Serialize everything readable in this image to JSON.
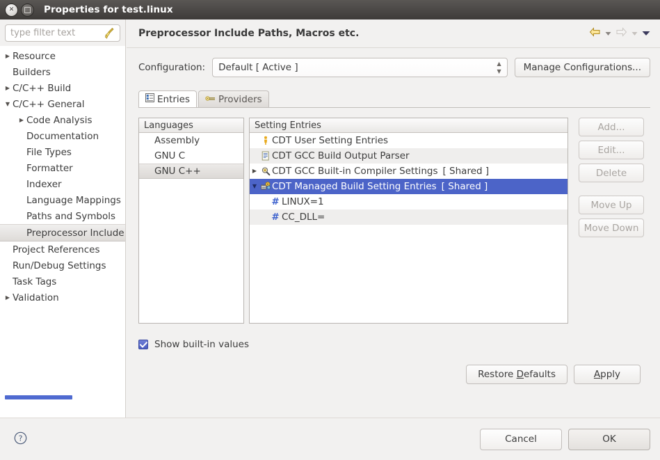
{
  "window": {
    "title": "Properties for test.linux",
    "close_icon": "close-icon",
    "maximize_icon": "maximize-icon"
  },
  "sidebar": {
    "filter_placeholder": "type filter text",
    "filter_value": "",
    "clear_icon": "broom-icon",
    "items": [
      {
        "label": "Resource",
        "indent": 0,
        "arrow": "collapsed",
        "selected": false
      },
      {
        "label": "Builders",
        "indent": 0,
        "arrow": "none",
        "selected": false
      },
      {
        "label": "C/C++ Build",
        "indent": 0,
        "arrow": "collapsed",
        "selected": false
      },
      {
        "label": "C/C++ General",
        "indent": 0,
        "arrow": "expanded",
        "selected": false
      },
      {
        "label": "Code Analysis",
        "indent": 1,
        "arrow": "collapsed",
        "selected": false
      },
      {
        "label": "Documentation",
        "indent": 1,
        "arrow": "none",
        "selected": false
      },
      {
        "label": "File Types",
        "indent": 1,
        "arrow": "none",
        "selected": false
      },
      {
        "label": "Formatter",
        "indent": 1,
        "arrow": "none",
        "selected": false
      },
      {
        "label": "Indexer",
        "indent": 1,
        "arrow": "none",
        "selected": false
      },
      {
        "label": "Language Mappings",
        "indent": 1,
        "arrow": "none",
        "selected": false
      },
      {
        "label": "Paths and Symbols",
        "indent": 1,
        "arrow": "none",
        "selected": false
      },
      {
        "label": "Preprocessor Include",
        "indent": 1,
        "arrow": "none",
        "selected": true
      },
      {
        "label": "Project References",
        "indent": 0,
        "arrow": "none",
        "selected": false
      },
      {
        "label": "Run/Debug Settings",
        "indent": 0,
        "arrow": "none",
        "selected": false
      },
      {
        "label": "Task Tags",
        "indent": 0,
        "arrow": "none",
        "selected": false
      },
      {
        "label": "Validation",
        "indent": 0,
        "arrow": "collapsed",
        "selected": false
      }
    ]
  },
  "page": {
    "title": "Preprocessor Include Paths, Macros etc.",
    "nav": {
      "back_icon": "back-arrow-icon",
      "back_menu_icon": "back-dropdown-icon",
      "forward_icon": "forward-arrow-icon",
      "forward_menu_icon": "forward-dropdown-icon",
      "view_menu_icon": "view-menu-icon"
    }
  },
  "configuration": {
    "label": "Configuration:",
    "value": "Default  [ Active ]",
    "manage_button": "Manage Configurations..."
  },
  "tabs": [
    {
      "label": "Entries",
      "icon": "entries-icon",
      "active": true
    },
    {
      "label": "Providers",
      "icon": "providers-icon",
      "active": false
    }
  ],
  "languages": {
    "header": "Languages",
    "items": [
      {
        "label": "Assembly",
        "selected": false
      },
      {
        "label": "GNU C",
        "selected": false
      },
      {
        "label": "GNU C++",
        "selected": true
      }
    ]
  },
  "setting_entries": {
    "header": "Setting Entries",
    "rows": [
      {
        "kind": "provider",
        "label": "CDT User Setting Entries",
        "shared": "",
        "icon": "user-setting-icon",
        "arrow": "none",
        "selected": false,
        "alt": false
      },
      {
        "kind": "provider",
        "label": "CDT GCC Build Output Parser",
        "shared": "",
        "icon": "output-parser-icon",
        "arrow": "none",
        "selected": false,
        "alt": true
      },
      {
        "kind": "provider",
        "label": "CDT GCC Built-in Compiler Settings",
        "shared": "[ Shared ]",
        "icon": "compiler-settings-icon",
        "arrow": "collapsed",
        "selected": false,
        "alt": false
      },
      {
        "kind": "provider",
        "label": "CDT Managed Build Setting Entries",
        "shared": "[ Shared ]",
        "icon": "managed-build-icon",
        "arrow": "expanded",
        "selected": true,
        "alt": false
      },
      {
        "kind": "macro",
        "label": "LINUX=1",
        "shared": "",
        "icon": "macro-icon",
        "arrow": "none",
        "selected": false,
        "alt": false
      },
      {
        "kind": "macro",
        "label": "CC_DLL=",
        "shared": "",
        "icon": "macro-icon",
        "arrow": "none",
        "selected": false,
        "alt": true
      }
    ]
  },
  "entry_buttons": [
    {
      "label": "Add...",
      "enabled": false,
      "gap": false
    },
    {
      "label": "Edit...",
      "enabled": false,
      "gap": false
    },
    {
      "label": "Delete",
      "enabled": false,
      "gap": false
    },
    {
      "label": "Move Up",
      "enabled": false,
      "gap": true
    },
    {
      "label": "Move Down",
      "enabled": false,
      "gap": false
    }
  ],
  "show_builtin": {
    "label": "Show built-in values",
    "checked": true
  },
  "apply_row": {
    "restore_defaults_pre": "Restore ",
    "restore_defaults_mnemonic": "D",
    "restore_defaults_post": "efaults",
    "apply_mnemonic": "A",
    "apply_post": "pply"
  },
  "footer": {
    "help_icon": "help-icon",
    "cancel": "Cancel",
    "ok": "OK"
  },
  "colors": {
    "selection_blue": "#4c64c8",
    "scrollbar_blue": "#4f6ad0",
    "titlebar_dark": "#3e3b39",
    "macro_hash": "#3a5fcd"
  }
}
